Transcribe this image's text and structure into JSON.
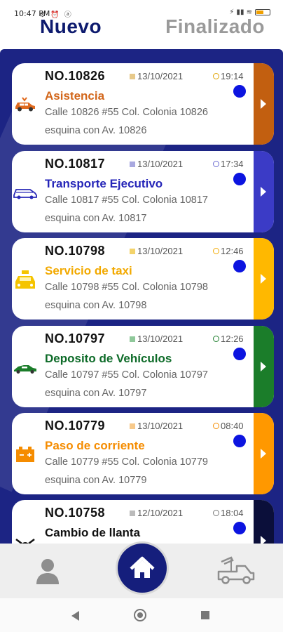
{
  "status_bar": {
    "time": "10:47 PM",
    "left_icons": "⚙ ⏰ ⓐ",
    "right_icons": "⚡ ▮▮ ≋"
  },
  "tabs": [
    {
      "label": "Nuevo",
      "active": true
    },
    {
      "label": "Finalizado",
      "active": false
    }
  ],
  "colors": {
    "panel": "#1c2484",
    "active_tab": "#0d1a6e",
    "inactive_tab": "#9a9a9a",
    "dot": "#0c14e0"
  },
  "orders": [
    {
      "number": "NO.10826",
      "date": "13/10/2021",
      "time": "19:14",
      "service": "Asistencia",
      "service_color": "#d2661a",
      "strip_color": "#c25f10",
      "icon": "car-assistance-icon",
      "address_line1": "Calle 10826 #55 Col. Colonia 10826",
      "address_line2": "esquina con Av. 10826"
    },
    {
      "number": "NO.10817",
      "date": "13/10/2021",
      "time": "17:34",
      "service": "Transporte Ejecutivo",
      "service_color": "#2525b8",
      "strip_color": "#3b3bc6",
      "icon": "van-icon",
      "address_line1": "Calle 10817 #55 Col. Colonia 10817",
      "address_line2": "esquina con Av. 10817"
    },
    {
      "number": "NO.10798",
      "date": "13/10/2021",
      "time": "12:46",
      "service": "Servicio de taxi",
      "service_color": "#f2a900",
      "strip_color": "#ffb800",
      "icon": "taxi-icon",
      "address_line1": "Calle 10798 #55 Col. Colonia 10798",
      "address_line2": "esquina con Av. 10798"
    },
    {
      "number": "NO.10797",
      "date": "13/10/2021",
      "time": "12:26",
      "service": "Deposito de Vehículos",
      "service_color": "#0d6b28",
      "strip_color": "#1b7d2a",
      "icon": "sedan-icon",
      "address_line1": "Calle 10797 #55 Col. Colonia 10797",
      "address_line2": "esquina con Av. 10797"
    },
    {
      "number": "NO.10779",
      "date": "13/10/2021",
      "time": "08:40",
      "service": "Paso de corriente",
      "service_color": "#f58c00",
      "strip_color": "#ff9800",
      "icon": "battery-icon",
      "address_line1": "Calle 10779 #55 Col. Colonia 10779",
      "address_line2": "esquina con Av. 10779"
    },
    {
      "number": "NO.10758",
      "date": "12/10/2021",
      "time": "18:04",
      "service": "Cambio de llanta",
      "service_color": "#111111",
      "strip_color": "#0b0f3a",
      "icon": "tire-tools-icon",
      "address_line1": "",
      "address_line2": ""
    }
  ],
  "bottom_nav": [
    {
      "name": "profile",
      "icon": "person-icon"
    },
    {
      "name": "home",
      "icon": "home-icon",
      "active": true
    },
    {
      "name": "tow",
      "icon": "tow-truck-icon"
    }
  ]
}
